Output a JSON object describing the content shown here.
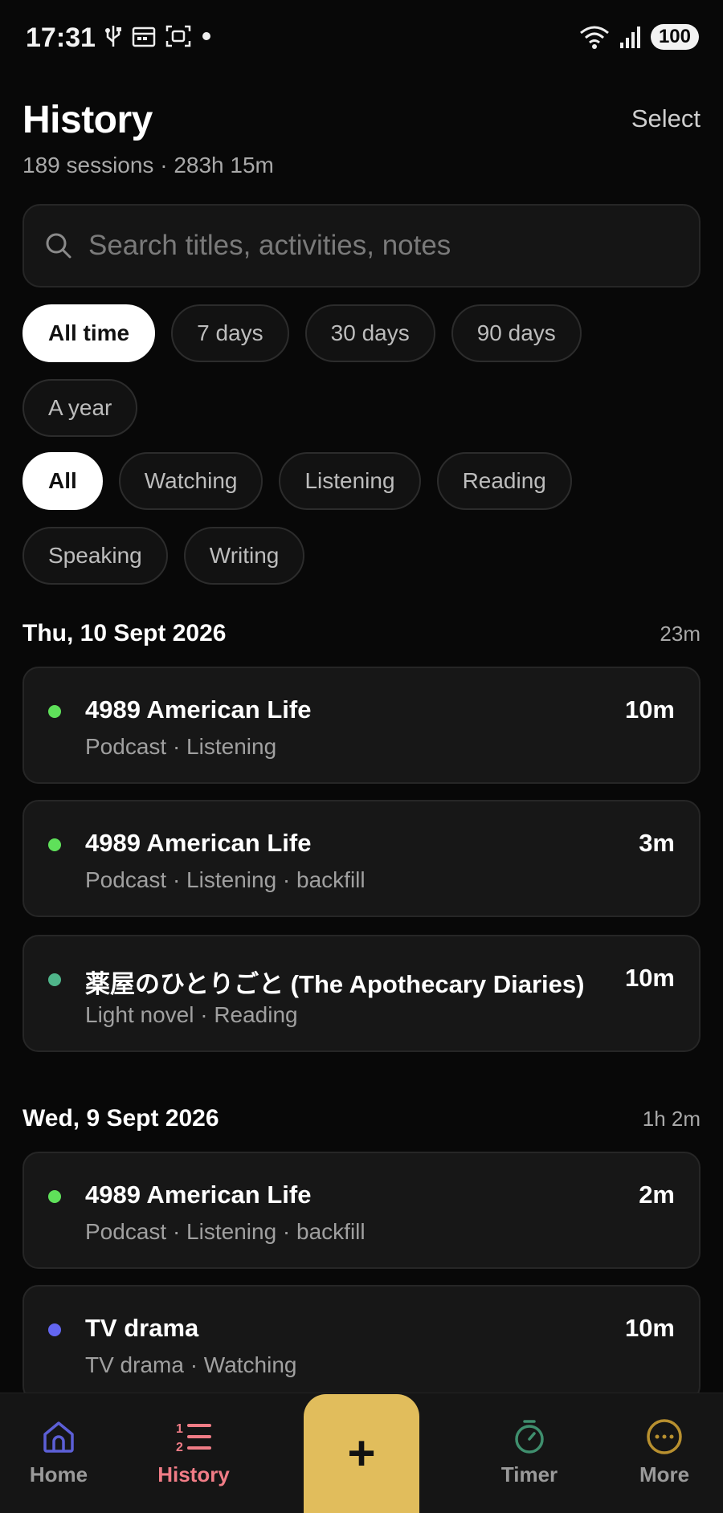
{
  "status_bar": {
    "time": "17:31",
    "battery": "100"
  },
  "header": {
    "title": "History",
    "select_label": "Select",
    "subtitle": "189 sessions · 283h 15m"
  },
  "search": {
    "placeholder": "Search titles, activities, notes",
    "value": ""
  },
  "time_filters": [
    {
      "label": "All time",
      "active": true
    },
    {
      "label": "7 days",
      "active": false
    },
    {
      "label": "30 days",
      "active": false
    },
    {
      "label": "90 days",
      "active": false
    },
    {
      "label": "A year",
      "active": false
    }
  ],
  "activity_filters": [
    {
      "label": "All",
      "active": true
    },
    {
      "label": "Watching",
      "active": false
    },
    {
      "label": "Listening",
      "active": false
    },
    {
      "label": "Reading",
      "active": false
    },
    {
      "label": "Speaking",
      "active": false
    },
    {
      "label": "Writing",
      "active": false
    }
  ],
  "days": [
    {
      "date": "Thu, 10 Sept 2026",
      "total": "23m",
      "sessions": [
        {
          "title": "4989 American Life",
          "meta": "Podcast · Listening",
          "duration": "10m",
          "dot_color": "#5fe05a"
        },
        {
          "title": "4989 American Life",
          "meta": "Podcast · Listening · backfill",
          "duration": "3m",
          "dot_color": "#5fe05a"
        },
        {
          "title": "薬屋のひとりごと (The Apothecary Diaries)",
          "meta": "Light novel · Reading",
          "duration": "10m",
          "dot_color": "#4fb58a"
        }
      ]
    },
    {
      "date": "Wed, 9 Sept 2026",
      "total": "1h 2m",
      "sessions": [
        {
          "title": "4989 American Life",
          "meta": "Podcast · Listening · backfill",
          "duration": "2m",
          "dot_color": "#5fe05a"
        },
        {
          "title": "TV drama",
          "meta": "TV drama · Watching",
          "duration": "10m",
          "dot_color": "#6366f1"
        }
      ]
    }
  ],
  "nav": {
    "home": {
      "label": "Home",
      "icon": "home-icon",
      "color": "#9a9a9a"
    },
    "history": {
      "label": "History",
      "icon": "list-icon",
      "color": "#f07c86"
    },
    "add": {
      "icon": "plus-icon",
      "color": "#e1bd5c"
    },
    "timer": {
      "label": "Timer",
      "icon": "stopwatch-icon",
      "color": "#9a9a9a"
    },
    "more": {
      "label": "More",
      "icon": "more-icon",
      "color": "#9a9a9a"
    }
  }
}
